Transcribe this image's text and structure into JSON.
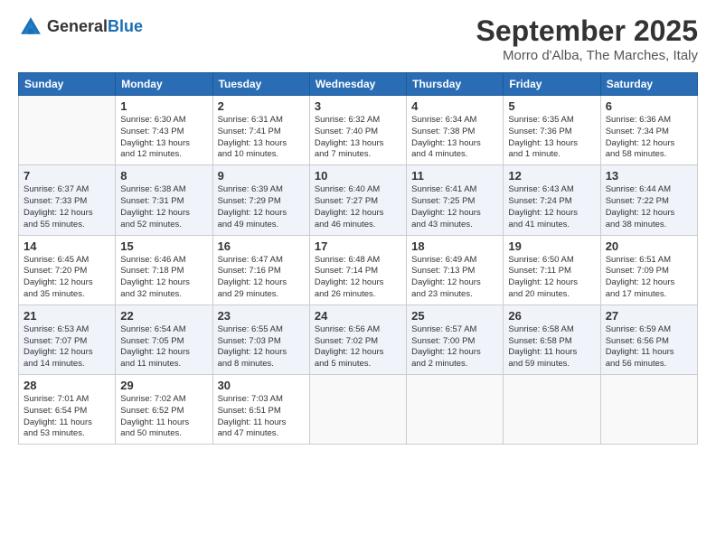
{
  "logo": {
    "general": "General",
    "blue": "Blue"
  },
  "header": {
    "month": "September 2025",
    "location": "Morro d'Alba, The Marches, Italy"
  },
  "weekdays": [
    "Sunday",
    "Monday",
    "Tuesday",
    "Wednesday",
    "Thursday",
    "Friday",
    "Saturday"
  ],
  "weeks": [
    [
      {
        "day": "",
        "info": ""
      },
      {
        "day": "1",
        "info": "Sunrise: 6:30 AM\nSunset: 7:43 PM\nDaylight: 13 hours\nand 12 minutes."
      },
      {
        "day": "2",
        "info": "Sunrise: 6:31 AM\nSunset: 7:41 PM\nDaylight: 13 hours\nand 10 minutes."
      },
      {
        "day": "3",
        "info": "Sunrise: 6:32 AM\nSunset: 7:40 PM\nDaylight: 13 hours\nand 7 minutes."
      },
      {
        "day": "4",
        "info": "Sunrise: 6:34 AM\nSunset: 7:38 PM\nDaylight: 13 hours\nand 4 minutes."
      },
      {
        "day": "5",
        "info": "Sunrise: 6:35 AM\nSunset: 7:36 PM\nDaylight: 13 hours\nand 1 minute."
      },
      {
        "day": "6",
        "info": "Sunrise: 6:36 AM\nSunset: 7:34 PM\nDaylight: 12 hours\nand 58 minutes."
      }
    ],
    [
      {
        "day": "7",
        "info": "Sunrise: 6:37 AM\nSunset: 7:33 PM\nDaylight: 12 hours\nand 55 minutes."
      },
      {
        "day": "8",
        "info": "Sunrise: 6:38 AM\nSunset: 7:31 PM\nDaylight: 12 hours\nand 52 minutes."
      },
      {
        "day": "9",
        "info": "Sunrise: 6:39 AM\nSunset: 7:29 PM\nDaylight: 12 hours\nand 49 minutes."
      },
      {
        "day": "10",
        "info": "Sunrise: 6:40 AM\nSunset: 7:27 PM\nDaylight: 12 hours\nand 46 minutes."
      },
      {
        "day": "11",
        "info": "Sunrise: 6:41 AM\nSunset: 7:25 PM\nDaylight: 12 hours\nand 43 minutes."
      },
      {
        "day": "12",
        "info": "Sunrise: 6:43 AM\nSunset: 7:24 PM\nDaylight: 12 hours\nand 41 minutes."
      },
      {
        "day": "13",
        "info": "Sunrise: 6:44 AM\nSunset: 7:22 PM\nDaylight: 12 hours\nand 38 minutes."
      }
    ],
    [
      {
        "day": "14",
        "info": "Sunrise: 6:45 AM\nSunset: 7:20 PM\nDaylight: 12 hours\nand 35 minutes."
      },
      {
        "day": "15",
        "info": "Sunrise: 6:46 AM\nSunset: 7:18 PM\nDaylight: 12 hours\nand 32 minutes."
      },
      {
        "day": "16",
        "info": "Sunrise: 6:47 AM\nSunset: 7:16 PM\nDaylight: 12 hours\nand 29 minutes."
      },
      {
        "day": "17",
        "info": "Sunrise: 6:48 AM\nSunset: 7:14 PM\nDaylight: 12 hours\nand 26 minutes."
      },
      {
        "day": "18",
        "info": "Sunrise: 6:49 AM\nSunset: 7:13 PM\nDaylight: 12 hours\nand 23 minutes."
      },
      {
        "day": "19",
        "info": "Sunrise: 6:50 AM\nSunset: 7:11 PM\nDaylight: 12 hours\nand 20 minutes."
      },
      {
        "day": "20",
        "info": "Sunrise: 6:51 AM\nSunset: 7:09 PM\nDaylight: 12 hours\nand 17 minutes."
      }
    ],
    [
      {
        "day": "21",
        "info": "Sunrise: 6:53 AM\nSunset: 7:07 PM\nDaylight: 12 hours\nand 14 minutes."
      },
      {
        "day": "22",
        "info": "Sunrise: 6:54 AM\nSunset: 7:05 PM\nDaylight: 12 hours\nand 11 minutes."
      },
      {
        "day": "23",
        "info": "Sunrise: 6:55 AM\nSunset: 7:03 PM\nDaylight: 12 hours\nand 8 minutes."
      },
      {
        "day": "24",
        "info": "Sunrise: 6:56 AM\nSunset: 7:02 PM\nDaylight: 12 hours\nand 5 minutes."
      },
      {
        "day": "25",
        "info": "Sunrise: 6:57 AM\nSunset: 7:00 PM\nDaylight: 12 hours\nand 2 minutes."
      },
      {
        "day": "26",
        "info": "Sunrise: 6:58 AM\nSunset: 6:58 PM\nDaylight: 11 hours\nand 59 minutes."
      },
      {
        "day": "27",
        "info": "Sunrise: 6:59 AM\nSunset: 6:56 PM\nDaylight: 11 hours\nand 56 minutes."
      }
    ],
    [
      {
        "day": "28",
        "info": "Sunrise: 7:01 AM\nSunset: 6:54 PM\nDaylight: 11 hours\nand 53 minutes."
      },
      {
        "day": "29",
        "info": "Sunrise: 7:02 AM\nSunset: 6:52 PM\nDaylight: 11 hours\nand 50 minutes."
      },
      {
        "day": "30",
        "info": "Sunrise: 7:03 AM\nSunset: 6:51 PM\nDaylight: 11 hours\nand 47 minutes."
      },
      {
        "day": "",
        "info": ""
      },
      {
        "day": "",
        "info": ""
      },
      {
        "day": "",
        "info": ""
      },
      {
        "day": "",
        "info": ""
      }
    ]
  ]
}
